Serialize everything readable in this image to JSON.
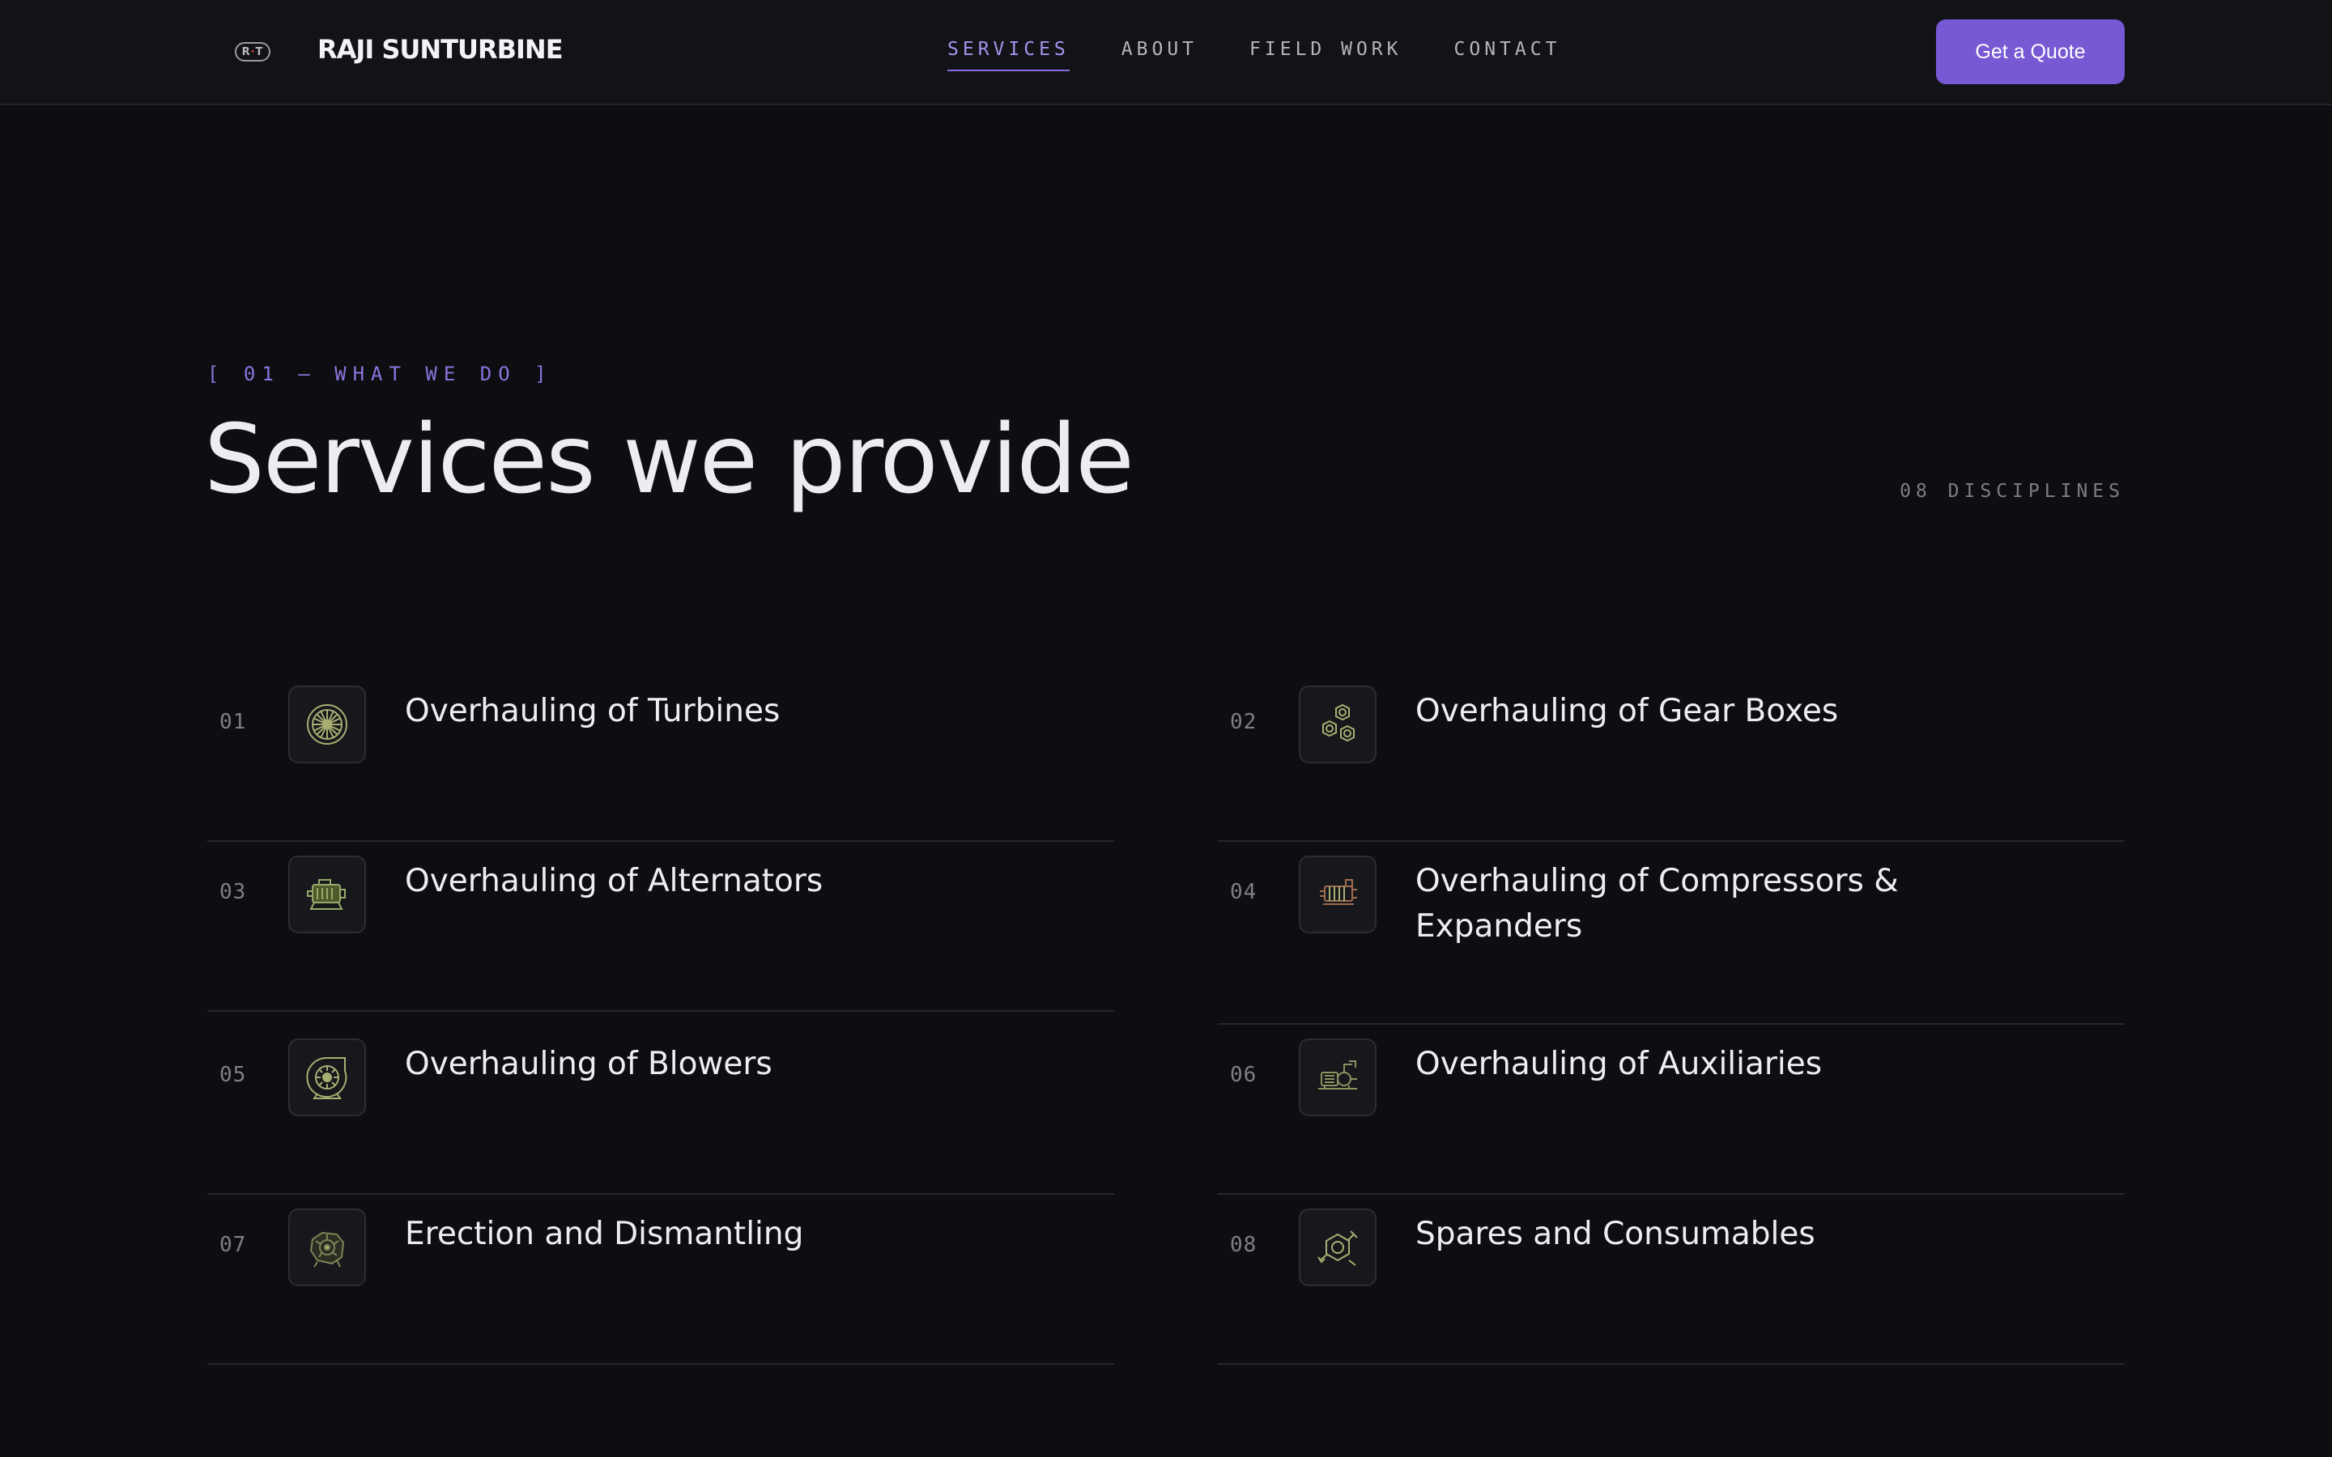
{
  "header": {
    "logo_text": "R·T",
    "logo_left": "R",
    "logo_dot": "·",
    "logo_right": "T",
    "brand": "RAJI SUNTURBINE",
    "nav": [
      {
        "label": "SERVICES",
        "active": true
      },
      {
        "label": "ABOUT",
        "active": false
      },
      {
        "label": "FIELD WORK",
        "active": false
      },
      {
        "label": "CONTACT",
        "active": false
      }
    ],
    "cta_label": "Get a Quote"
  },
  "section": {
    "eyebrow": "[ 01 — WHAT WE DO ]",
    "title": "Services we provide",
    "count_label": "08 DISCIPLINES"
  },
  "services": [
    {
      "num": "01",
      "title": "Overhauling of Turbines",
      "icon": "turbine-icon"
    },
    {
      "num": "02",
      "title": "Overhauling of Gear Boxes",
      "icon": "gears-icon"
    },
    {
      "num": "03",
      "title": "Overhauling of Alternators",
      "icon": "alternator-icon"
    },
    {
      "num": "04",
      "title": "Overhauling of Compressors & Expanders",
      "icon": "compressor-icon"
    },
    {
      "num": "05",
      "title": "Overhauling of Blowers",
      "icon": "blower-icon"
    },
    {
      "num": "06",
      "title": "Overhauling of Auxiliaries",
      "icon": "pump-icon"
    },
    {
      "num": "07",
      "title": "Erection and Dismantling",
      "icon": "engine-icon"
    },
    {
      "num": "08",
      "title": "Spares and Consumables",
      "icon": "nut-wrench-icon"
    }
  ],
  "colors": {
    "background": "#0d0e12",
    "accent": "#7659d3",
    "accent_text": "#a792ec",
    "icon_stroke": "#a8ae72"
  }
}
